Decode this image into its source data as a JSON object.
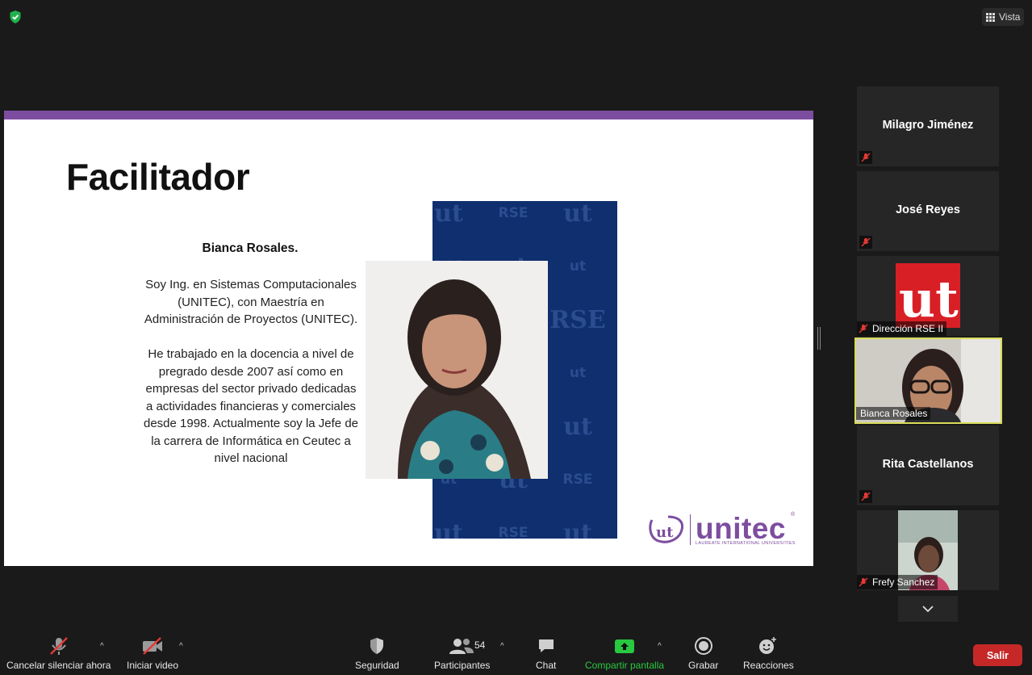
{
  "top_bar": {
    "security_status_icon": "green-shield-check-icon",
    "view_button_label": "Vista",
    "view_button_icon": "grid-icon"
  },
  "shared_slide": {
    "accent_color": "#7d4ea0",
    "title": "Facilitador",
    "bio_name": "Bianca Rosales.",
    "bio_paragraph_1": "Soy Ing. en Sistemas Computacionales (UNITEC), con Maestría en Administración de Proyectos (UNITEC).",
    "bio_paragraph_2": "He trabajado en la docencia a nivel de pregrado desde 2007 así como en empresas del sector privado dedicadas a actividades financieras y comerciales desde 1998. Actualmente soy la Jefe de  la carrera de Informática en Ceutec a nivel nacional",
    "pattern_glyphs": [
      "ut",
      "RSE",
      "ut"
    ],
    "logo": {
      "word": "unitec",
      "subtitle": "LAUREATE INTERNATIONAL UNIVERSITIES",
      "registered_mark": "®",
      "mark_text": "ut"
    }
  },
  "participants": [
    {
      "name": "Milagro Jiménez",
      "muted": true,
      "video": false
    },
    {
      "name": "José Reyes",
      "muted": true,
      "video": false
    },
    {
      "name": "Dirección RSE II",
      "muted": true,
      "video": false,
      "avatar_text": "ut"
    },
    {
      "name": "Bianca Rosales",
      "muted": false,
      "video": true,
      "active_speaker": true
    },
    {
      "name": "Rita Castellanos",
      "muted": true,
      "video": false
    },
    {
      "name": "Frefy Sanchez",
      "muted": true,
      "video": true
    }
  ],
  "toolbar": {
    "mute_label": "Cancelar silenciar ahora",
    "video_label": "Iniciar video",
    "security_label": "Seguridad",
    "participants_label": "Participantes",
    "participants_count": "54",
    "chat_label": "Chat",
    "share_label": "Compartir pantalla",
    "record_label": "Grabar",
    "reactions_label": "Reacciones",
    "leave_label": "Salir",
    "caret": "^",
    "colors": {
      "share_green": "#28c840",
      "leave_red": "#c62828",
      "active_border": "#d9dc59"
    }
  }
}
